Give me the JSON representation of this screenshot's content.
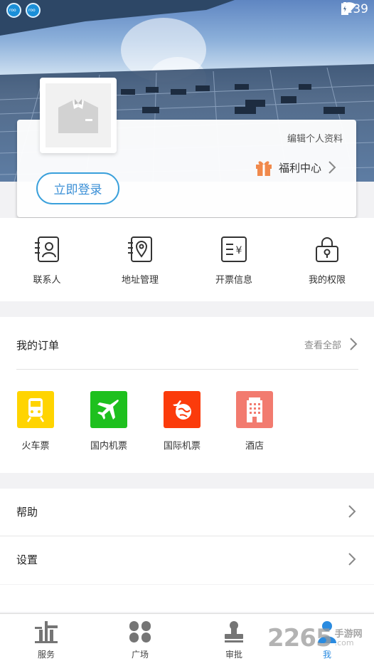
{
  "status_bar": {
    "time": "3:39"
  },
  "profile": {
    "edit_label": "编辑个人资料",
    "welfare_label": "福利中心",
    "login_label": "立即登录"
  },
  "quick_actions": [
    {
      "label": "联系人",
      "icon": "contacts-icon"
    },
    {
      "label": "地址管理",
      "icon": "address-icon"
    },
    {
      "label": "开票信息",
      "icon": "invoice-icon"
    },
    {
      "label": "我的权限",
      "icon": "lock-icon"
    }
  ],
  "orders": {
    "title": "我的订单",
    "view_all": "查看全部",
    "items": [
      {
        "label": "火车票",
        "icon": "train-icon",
        "color": "#ffd400"
      },
      {
        "label": "国内机票",
        "icon": "plane-icon",
        "color": "#1ec01e"
      },
      {
        "label": "国际机票",
        "icon": "globe-plane-icon",
        "color": "#fb3b0b"
      },
      {
        "label": "酒店",
        "icon": "hotel-icon",
        "color": "#f27b6f"
      }
    ]
  },
  "menu": [
    {
      "label": "帮助"
    },
    {
      "label": "设置"
    }
  ],
  "tabs": [
    {
      "label": "服务",
      "icon": "building-icon"
    },
    {
      "label": "广场",
      "icon": "clover-icon"
    },
    {
      "label": "审批",
      "icon": "stamp-icon"
    },
    {
      "label": "我",
      "icon": "user-icon"
    }
  ],
  "colors": {
    "accent": "#2a8be0",
    "login_border": "#3aa0db"
  },
  "watermark": {
    "number": "2265",
    "site": "手游网",
    "domain": ".com"
  }
}
